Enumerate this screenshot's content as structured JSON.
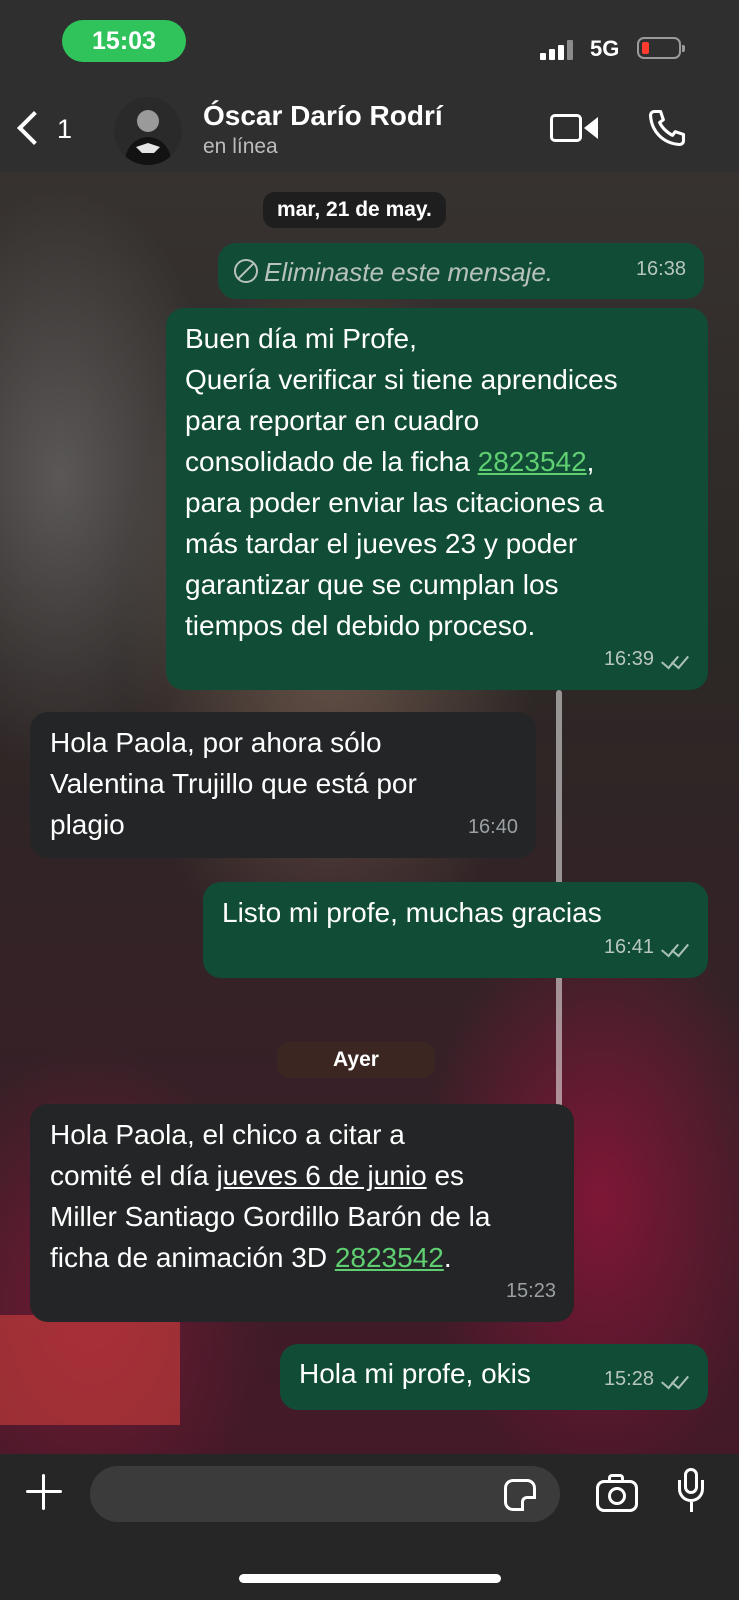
{
  "status_bar": {
    "time": "15:03",
    "network": "5G"
  },
  "header": {
    "back_count": "1",
    "contact_name": "Óscar Darío Rodrí",
    "contact_status": "en línea"
  },
  "date_separators": [
    "mar, 21 de may.",
    "Ayer"
  ],
  "messages": [
    {
      "direction": "out",
      "deleted": true,
      "text": "Eliminaste este mensaje.",
      "time": "16:38"
    },
    {
      "direction": "out",
      "text_intro": "Buen día mi Profe,\nQuería verificar si tiene aprendices\npara reportar en cuadro\nconsolidado de la ficha ",
      "link": "2823542",
      "text_rest": ",\npara poder enviar las citaciones a\nmás tardar el jueves 23 y poder\ngarantizar que se cumplan los\ntiempos del debido proceso.",
      "time": "16:39",
      "read": true
    },
    {
      "direction": "in",
      "text": "Hola Paola, por ahora sólo\nValentina Trujillo que está por\nplagio",
      "time": "16:40"
    },
    {
      "direction": "out",
      "text": "Listo mi profe, muchas gracias",
      "time": "16:41",
      "read": true
    },
    {
      "direction": "in",
      "text_a": "Hola Paola, el chico a citar a\ncomité el día ",
      "underlined": "jueves 6 de junio",
      "text_b": " es\nMiller Santiago Gordillo Barón de la\nficha de animación 3D ",
      "link": "2823542",
      "text_c": ".",
      "time": "15:23"
    },
    {
      "direction": "out",
      "text": "Hola mi profe, okis",
      "time": "15:28",
      "read": true
    }
  ],
  "composer": {
    "value": ""
  },
  "colors": {
    "outgoing_bubble": "#114d36",
    "incoming_bubble": "#232526",
    "link": "#5fcf72",
    "time_pill": "#30c35b",
    "battery_low": "#ff3b30"
  },
  "icons": [
    "back-chevron-icon",
    "video-call-icon",
    "phone-icon",
    "plus-icon",
    "sticker-icon",
    "camera-icon",
    "microphone-icon",
    "read-receipt-icon",
    "deleted-icon"
  ]
}
